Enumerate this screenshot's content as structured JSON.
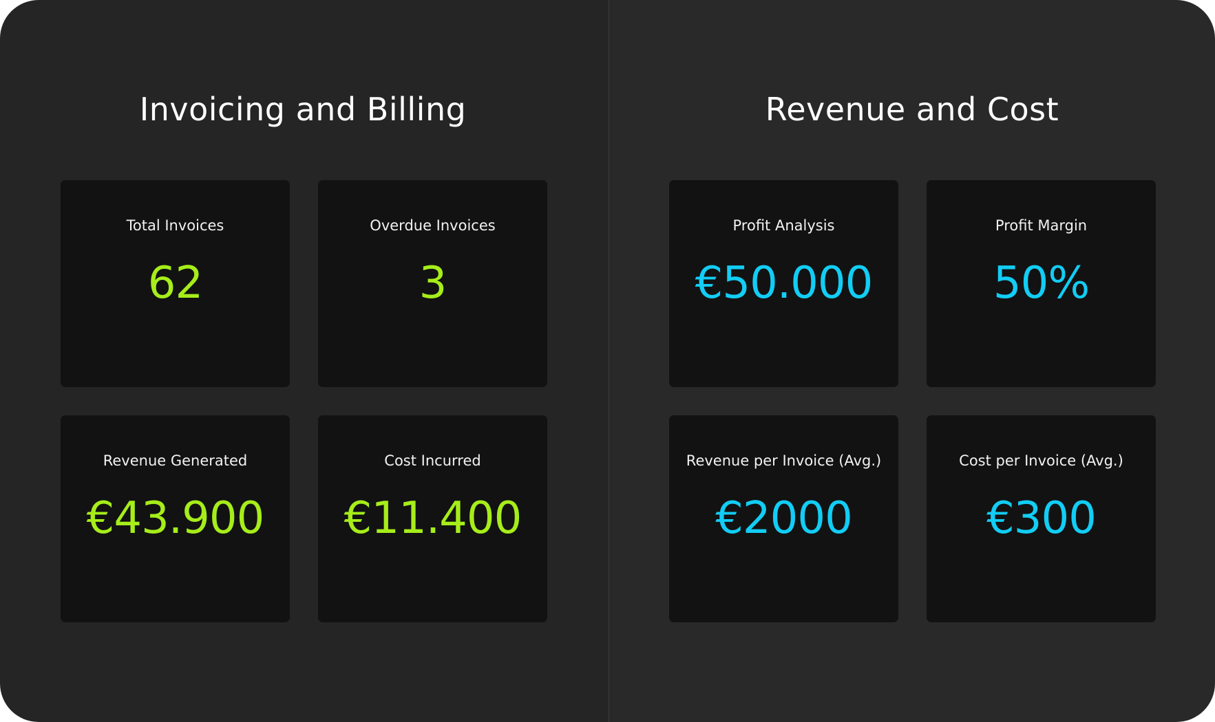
{
  "colors": {
    "left_panel_bg": "#252525",
    "right_panel_bg": "#292929",
    "card_bg": "#121212",
    "billing_accent": "#a6ed1a",
    "revenue_accent": "#12cdf5"
  },
  "invoicing": {
    "title": "Invoicing and Billing",
    "cards": [
      {
        "label": "Total Invoices",
        "value": "62"
      },
      {
        "label": "Overdue Invoices",
        "value": "3"
      },
      {
        "label": "Revenue Generated",
        "value": "€43.900"
      },
      {
        "label": "Cost Incurred",
        "value": "€11.400"
      }
    ]
  },
  "revenue": {
    "title": "Revenue and Cost",
    "cards": [
      {
        "label": "Profit Analysis",
        "value": "€50.000"
      },
      {
        "label": "Profit Margin",
        "value": "50%"
      },
      {
        "label": "Revenue per Invoice (Avg.)",
        "value": "€2000"
      },
      {
        "label": "Cost per Invoice (Avg.)",
        "value": "€300"
      }
    ]
  }
}
